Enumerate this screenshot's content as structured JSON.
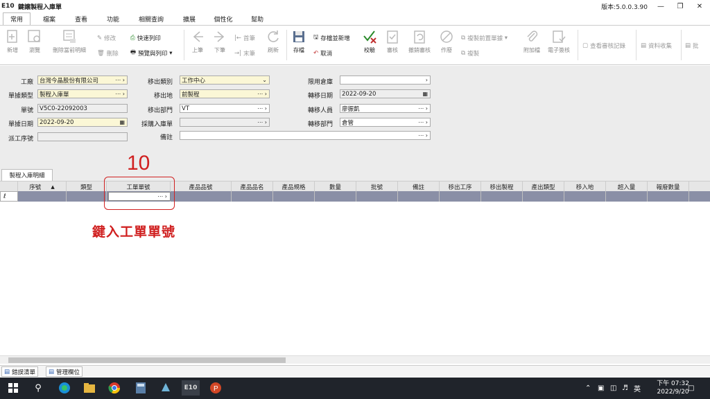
{
  "window": {
    "logo": "E10",
    "title": "鍵譲製程入庫單",
    "version": "版本:5.0.0.3.90"
  },
  "menu_tabs": [
    "常用",
    "檔案",
    "查看",
    "功能",
    "相關查詢",
    "擴展",
    "個性化",
    "幫助"
  ],
  "ribbon": {
    "new": "新增",
    "browse": "瀏覽",
    "delete_current_detail": "刪除當前明細",
    "modify": "修改",
    "delete": "刪除",
    "quick_print": "快速列印",
    "preview_print": "預覽與列印",
    "prev": "上筆",
    "next": "下筆",
    "first": "首筆",
    "last": "末筆",
    "refresh": "刷新",
    "save": "存檔",
    "save_and_new": "存檔並新增",
    "cancel": "取消",
    "verify": "校驗",
    "approve": "審核",
    "unapprove": "撤銷審核",
    "void": "作廢",
    "copy_prev_doc": "複製前置單據",
    "copy": "複製",
    "attachment": "附加檔",
    "esign": "電子簽核",
    "view_audit": "查看審核記錄",
    "data_collect": "資料收集",
    "more": "批"
  },
  "form": {
    "factory": {
      "label": "工廠",
      "value": "台灣今晶股份有限公司"
    },
    "doc_type": {
      "label": "單據類型",
      "value": "製程入庫單"
    },
    "doc_no": {
      "label": "單號",
      "value": "V5C0-22092003"
    },
    "doc_date": {
      "label": "單據日期",
      "value": "2022-09-20"
    },
    "dispatch_seq": {
      "label": "派工序號",
      "value": ""
    },
    "move_out_type": {
      "label": "移出類別",
      "value": "工作中心"
    },
    "move_out_place": {
      "label": "移出地",
      "value": "前製程"
    },
    "move_out_dept": {
      "label": "移出部門",
      "value": "VT"
    },
    "purchase_receipt": {
      "label": "採購入庫單",
      "value": ""
    },
    "remark": {
      "label": "備註",
      "value": ""
    },
    "limit_warehouse": {
      "label": "限用倉庫",
      "value": ""
    },
    "transfer_date": {
      "label": "轉移日期",
      "value": "2022-09-20"
    },
    "transfer_person": {
      "label": "轉移人員",
      "value": "廖振凱"
    },
    "transfer_dept": {
      "label": "轉移部門",
      "value": "倉管"
    }
  },
  "detail_tab": "製程入庫明細",
  "grid_columns": [
    "序號",
    "類型",
    "工單單號",
    "產品品號",
    "產品品名",
    "產品規格",
    "數量",
    "批號",
    "備註",
    "移出工序",
    "移出製程",
    "產出類型",
    "移入地",
    "超入量",
    "報廢數量"
  ],
  "annotation": {
    "step": "10",
    "instruction": "鍵入工單單號"
  },
  "bottom_tabs": [
    "錯誤清單",
    "管理欄位"
  ],
  "taskbar": {
    "app_label": "E10",
    "ime": "英",
    "time": "下午 07:32",
    "date": "2022/9/20"
  },
  "colors": {
    "annotation": "#d02020",
    "selected_row": "#8a8fa6",
    "required_field": "#fbf7d6"
  }
}
